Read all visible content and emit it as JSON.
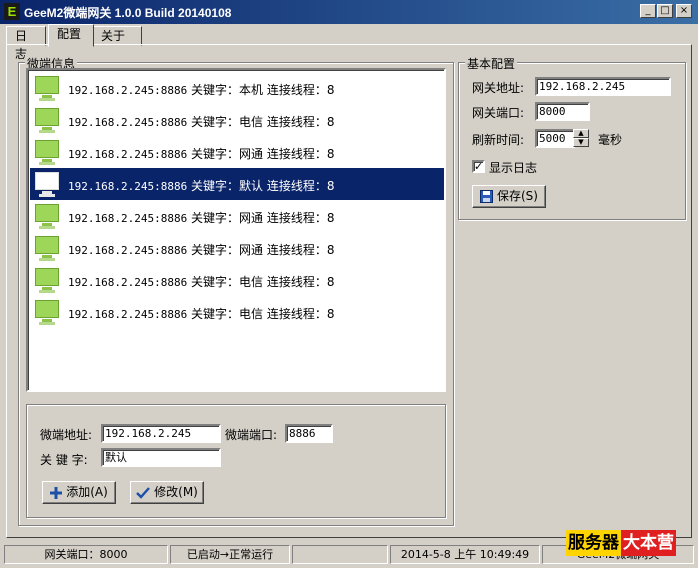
{
  "window": {
    "title": "GeeM2微端网关 1.0.0 Build 20140108",
    "icon_letter": "E",
    "buttons": {
      "minimize": "_",
      "maximize": "□",
      "close": "×"
    }
  },
  "tabs": [
    {
      "label": "日志"
    },
    {
      "label": "配置"
    },
    {
      "label": "关于"
    }
  ],
  "client_list": {
    "title": "微端信息",
    "rows": [
      {
        "addr": "192.168.2.245:8886",
        "text": " 关键字：本机 连接线程：8",
        "selected": false
      },
      {
        "addr": "192.168.2.245:8886",
        "text": " 关键字：电信 连接线程：8",
        "selected": false
      },
      {
        "addr": "192.168.2.245:8886",
        "text": " 关键字：网通 连接线程：8",
        "selected": false
      },
      {
        "addr": "192.168.2.245:8886",
        "text": " 关键字：默认 连接线程：8",
        "selected": true
      },
      {
        "addr": "192.168.2.245:8886",
        "text": " 关键字：网通 连接线程：8",
        "selected": false
      },
      {
        "addr": "192.168.2.245:8886",
        "text": " 关键字：网通 连接线程：8",
        "selected": false
      },
      {
        "addr": "192.168.2.245:8886",
        "text": " 关键字：电信 连接线程：8",
        "selected": false
      },
      {
        "addr": "192.168.2.245:8886",
        "text": " 关键字：电信 连接线程：8",
        "selected": false
      }
    ]
  },
  "edit_panel": {
    "addr_label": "微端地址:",
    "addr_value": "192.168.2.245",
    "port_label": "微端端口:",
    "port_value": "8886",
    "keyword_label": "关 键 字:",
    "keyword_value": "默认",
    "add_label": "添加(A)",
    "modify_label": "修改(M)"
  },
  "basic_config": {
    "title": "基本配置",
    "gw_addr_label": "网关地址:",
    "gw_addr_value": "192.168.2.245",
    "gw_port_label": "网关端口:",
    "gw_port_value": "8000",
    "refresh_label": "刷新时间:",
    "refresh_value": "5000",
    "refresh_unit": "毫秒",
    "show_log_label": "显示日志",
    "show_log_checked": true,
    "save_label": "保存(S)"
  },
  "statusbar": {
    "port": "网关端口：8000",
    "state": "已启动→正常运行",
    "empty": "",
    "datetime": "2014-5-8 上午 10:49:49",
    "app": "GeeM2微端网关"
  },
  "watermark": {
    "part1": "服务器",
    "part2": "大本营"
  },
  "colors": {
    "title_bar": "#0a246a",
    "selection": "#0a246a",
    "monitor_icon": "#9ed65a",
    "face": "#d4d0c8"
  }
}
